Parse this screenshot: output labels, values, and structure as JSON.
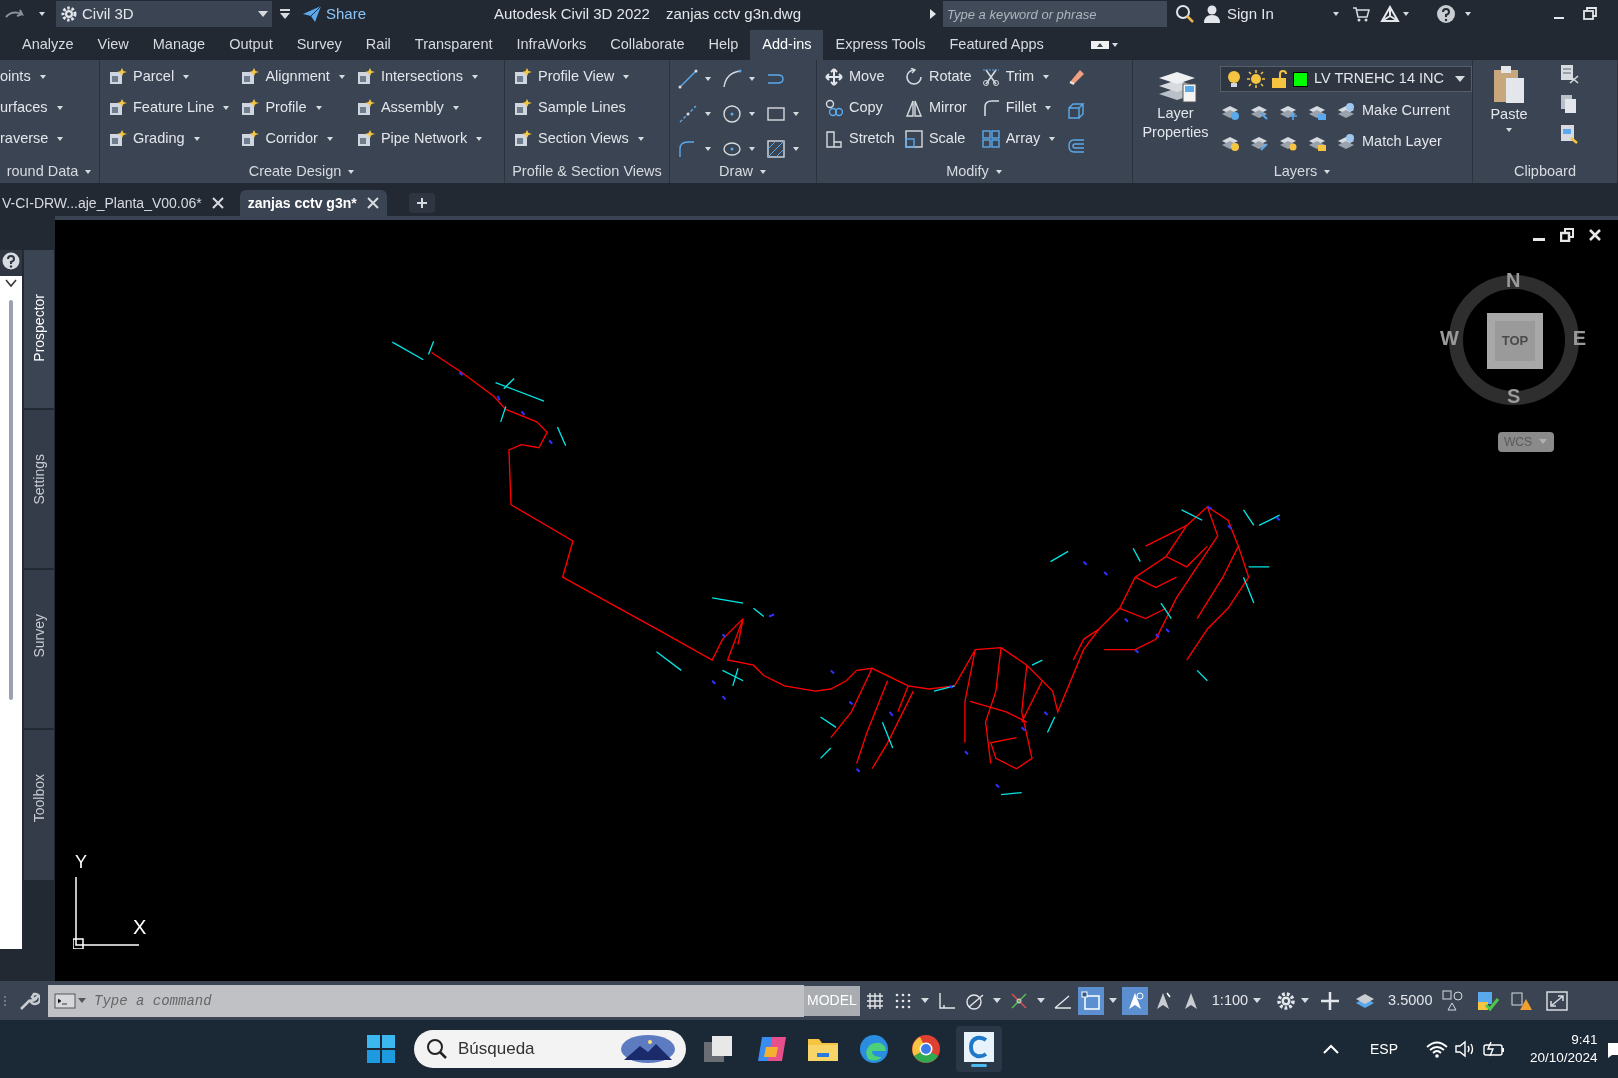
{
  "title_bar": {
    "workspace": "Civil 3D",
    "share": "Share",
    "app_title": "Autodesk Civil 3D 2022",
    "file_name": "zanjas cctv g3n.dwg",
    "search": {
      "placeholder": "Type a keyword or phrase"
    },
    "sign_in": "Sign In"
  },
  "ribbon_tabs": [
    {
      "label": "Analyze",
      "selected": false
    },
    {
      "label": "View",
      "selected": false
    },
    {
      "label": "Manage",
      "selected": false
    },
    {
      "label": "Output",
      "selected": false
    },
    {
      "label": "Survey",
      "selected": false
    },
    {
      "label": "Rail",
      "selected": false
    },
    {
      "label": "Transparent",
      "selected": false
    },
    {
      "label": "InfraWorks",
      "selected": false
    },
    {
      "label": "Collaborate",
      "selected": false
    },
    {
      "label": "Help",
      "selected": false
    },
    {
      "label": "Add-ins",
      "selected": true
    },
    {
      "label": "Express Tools",
      "selected": false
    },
    {
      "label": "Featured Apps",
      "selected": false
    }
  ],
  "ribbon_panels": [
    {
      "kind": "tools",
      "title": "round Data",
      "title_menu": true,
      "columns": [
        [
          {
            "label": "oints",
            "dropdown": true
          },
          {
            "label": "urfaces",
            "dropdown": true
          },
          {
            "label": "raverse",
            "dropdown": true
          }
        ]
      ]
    },
    {
      "kind": "tools",
      "title": "Create Design",
      "title_menu": true,
      "columns": [
        [
          {
            "label": "Parcel",
            "dropdown": true
          },
          {
            "label": "Feature Line",
            "dropdown": true
          },
          {
            "label": "Grading",
            "dropdown": true
          }
        ],
        [
          {
            "label": "Alignment",
            "dropdown": true
          },
          {
            "label": "Profile",
            "dropdown": true
          },
          {
            "label": "Corridor",
            "dropdown": true
          }
        ],
        [
          {
            "label": "Intersections",
            "dropdown": true
          },
          {
            "label": "Assembly",
            "dropdown": true
          },
          {
            "label": "Pipe Network",
            "dropdown": true
          }
        ]
      ]
    },
    {
      "kind": "tools",
      "title": "Profile & Section Views",
      "title_menu": false,
      "columns": [
        [
          {
            "label": "Profile View",
            "dropdown": true
          },
          {
            "label": "Sample Lines",
            "dropdown": false
          },
          {
            "label": "Section Views",
            "dropdown": true
          }
        ]
      ]
    },
    {
      "kind": "draw",
      "title": "Draw",
      "title_menu": true
    },
    {
      "kind": "tools",
      "title": "Modify",
      "title_menu": true,
      "columns": [
        [
          {
            "label": "Move",
            "dropdown": false
          },
          {
            "label": "Copy",
            "dropdown": false
          },
          {
            "label": "Stretch",
            "dropdown": false
          }
        ],
        [
          {
            "label": "Rotate",
            "dropdown": false
          },
          {
            "label": "Mirror",
            "dropdown": false
          },
          {
            "label": "Scale",
            "dropdown": false
          }
        ],
        [
          {
            "label": "Trim",
            "dropdown": true
          },
          {
            "label": "Fillet",
            "dropdown": true
          },
          {
            "label": "Array",
            "dropdown": true
          }
        ]
      ]
    },
    {
      "kind": "layers",
      "title": "Layers",
      "title_menu": true,
      "big_button": "Layer Properties",
      "current_layer": {
        "name": "LV TRNEHC 14 INC",
        "color": "#00ff00"
      },
      "actions": [
        "Make Current",
        "Match Layer"
      ]
    },
    {
      "kind": "clipboard",
      "title": "Clipboard",
      "title_menu": false,
      "big_button": "Paste"
    }
  ],
  "document_tabs": [
    {
      "label": "V-CI-DRW...aje_Planta_V00.06*",
      "selected": false
    },
    {
      "label": "zanjas cctv g3n*",
      "selected": true
    }
  ],
  "palette_tabs": [
    {
      "label": "Prospector",
      "selected": true
    },
    {
      "label": "Settings",
      "selected": false
    },
    {
      "label": "Survey",
      "selected": false
    },
    {
      "label": "Toolbox",
      "selected": false
    }
  ],
  "viewcube": {
    "north": "N",
    "west": "W",
    "east": "E",
    "south": "S",
    "face": "TOP",
    "ucs_menu": "WCS"
  },
  "ucs_icon": {
    "x_label": "X",
    "y_label": "Y"
  },
  "command_line": {
    "placeholder": "Type a command"
  },
  "status_bar": {
    "model": "MODEL",
    "scale": "1:100",
    "annotation_scale": "3.5000",
    "toggles": [
      {
        "on": false
      },
      {
        "on": false
      },
      {
        "on": false
      },
      {
        "on": false
      },
      {
        "on": false
      },
      {
        "on": false
      },
      {
        "on": true
      },
      {
        "on": true
      },
      {
        "on": false
      },
      {
        "on": false
      }
    ]
  },
  "taskbar": {
    "search": {
      "placeholder": "Búsqueda"
    },
    "language": "ESP",
    "time": "9:41",
    "date": "20/10/2024"
  }
}
